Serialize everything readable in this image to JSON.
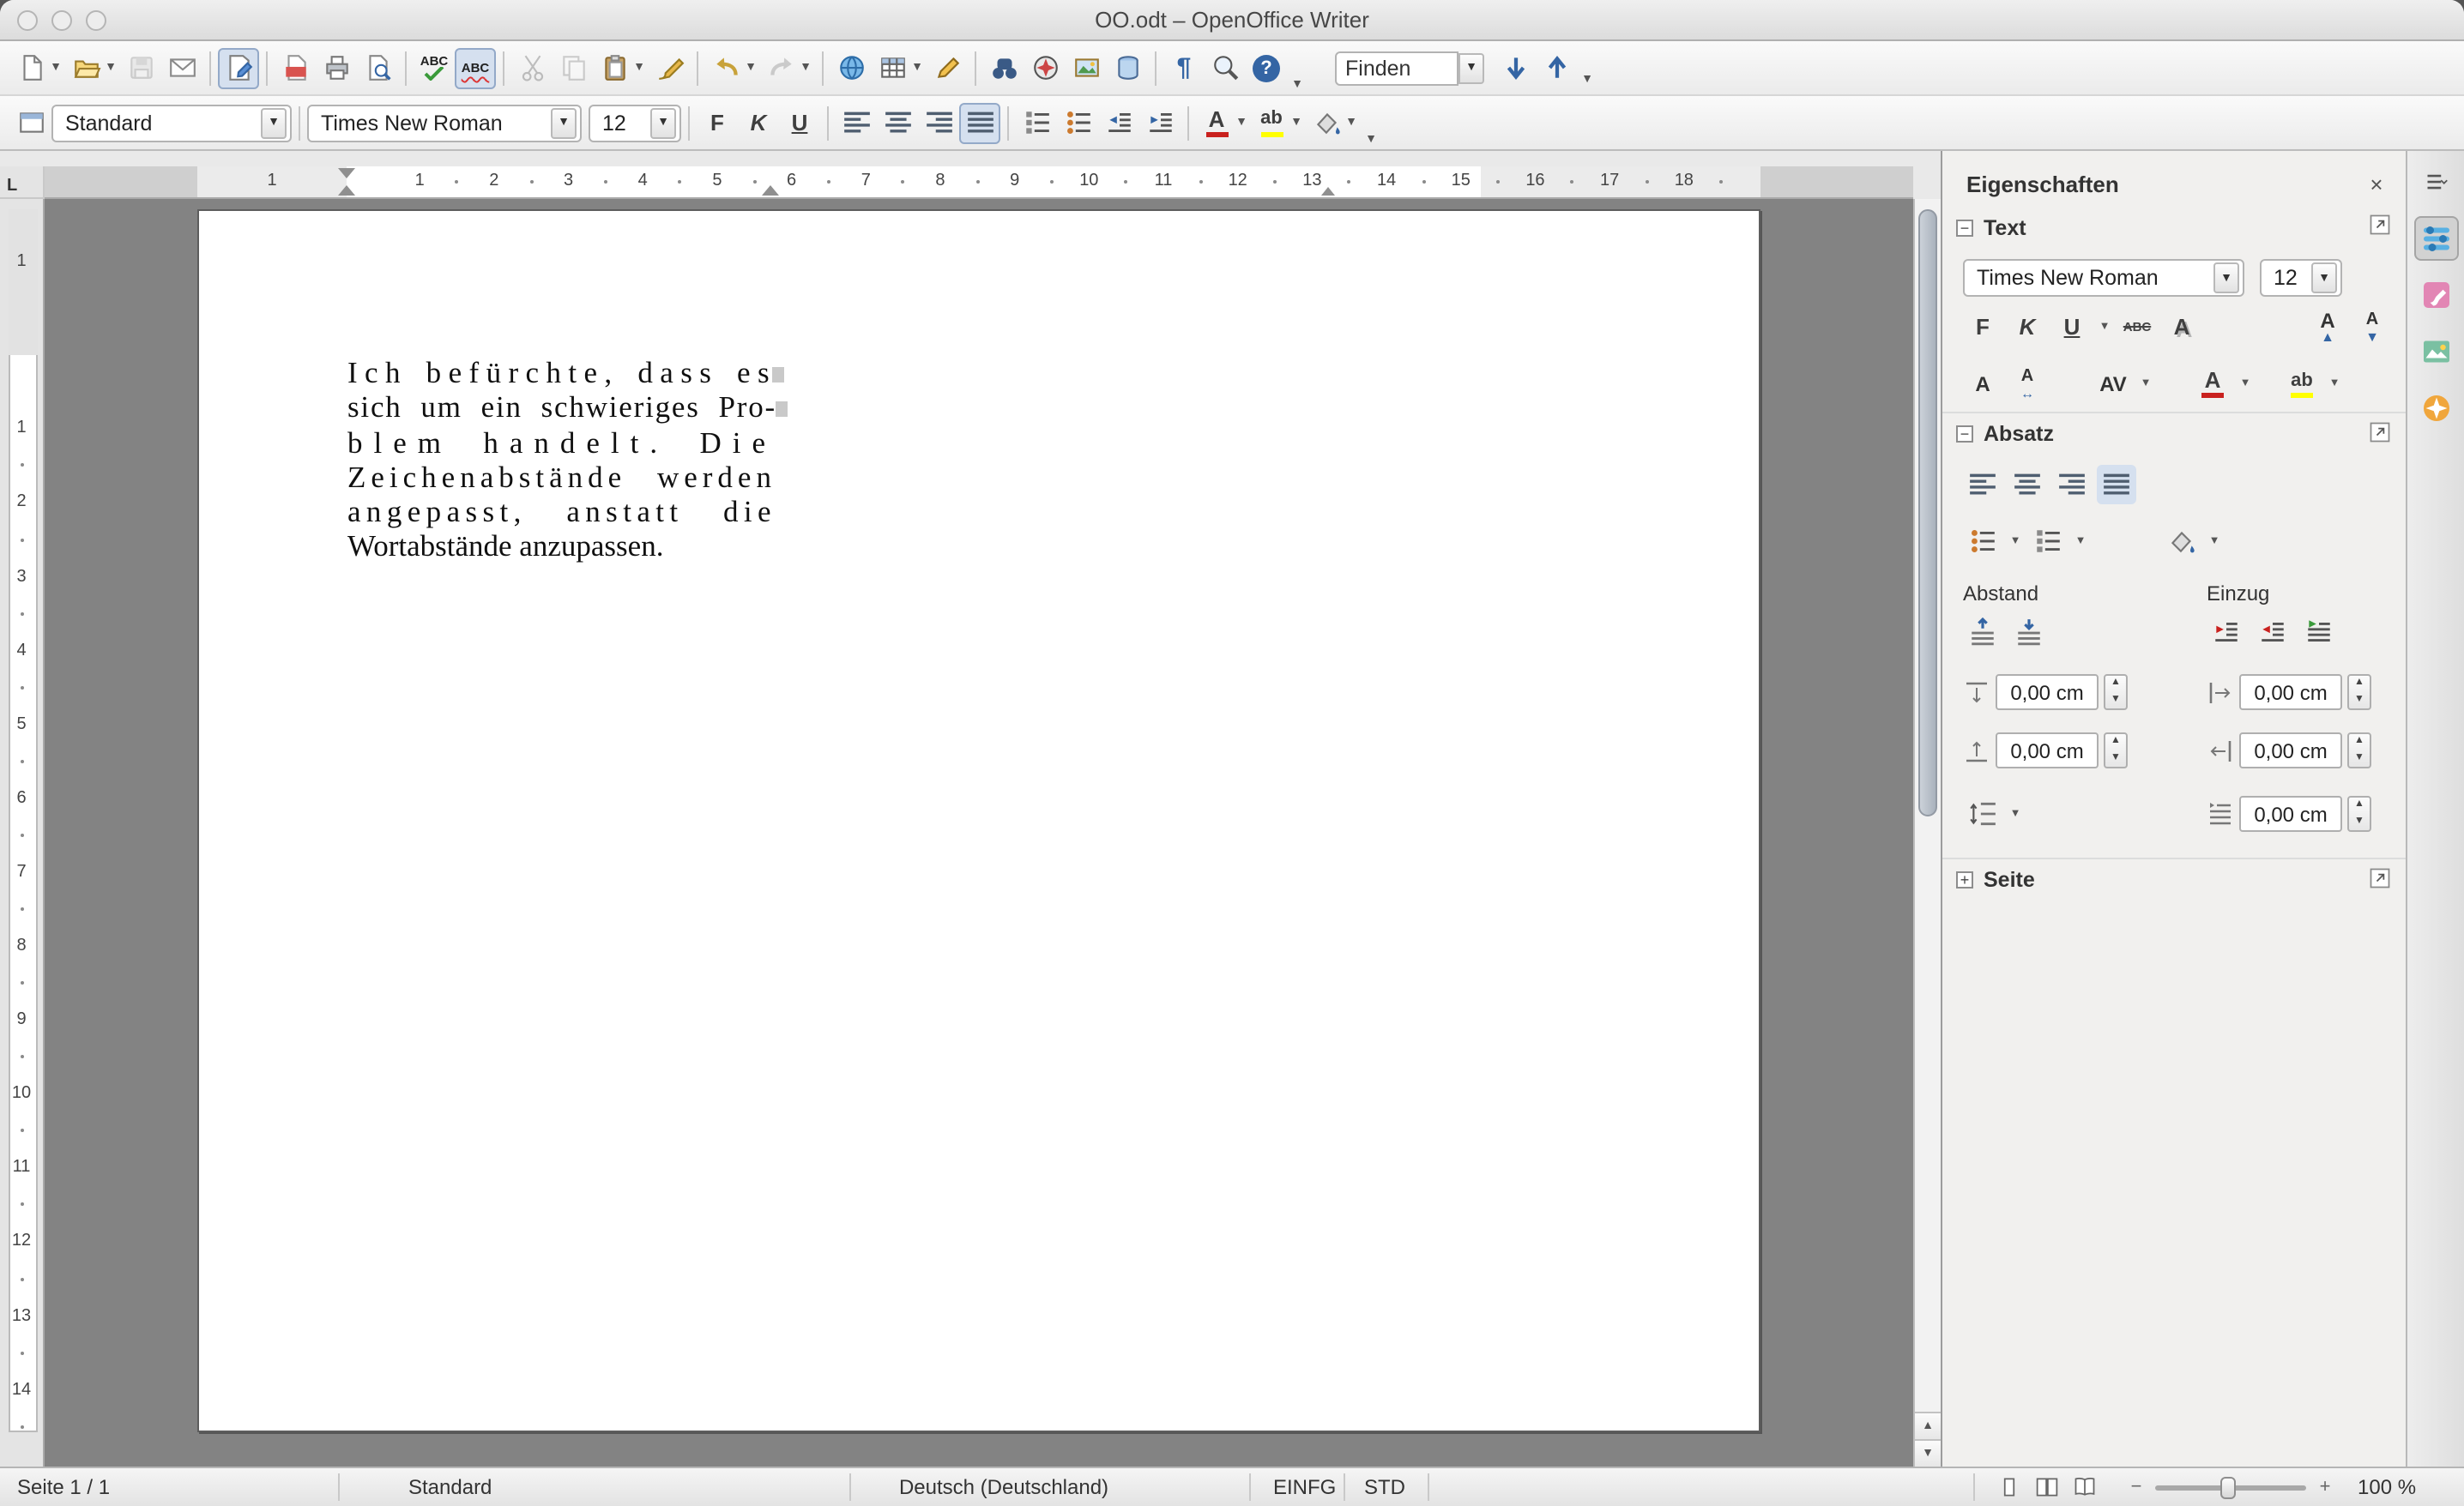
{
  "window": {
    "title": "OO.odt – OpenOffice Writer"
  },
  "toolbar_main": {
    "find_value": "Finden"
  },
  "toolbar_format": {
    "style_value": "Standard",
    "font_value": "Times New Roman",
    "size_value": "12"
  },
  "icons": {
    "close": "×",
    "collapse": "−",
    "expand": "+",
    "bold": "F",
    "italic": "K",
    "underline": "U",
    "strike": "ABC",
    "shadow": "A",
    "spell": "ABC",
    "help": "?",
    "fontcolor_letter": "A",
    "highlight_letters": "ab",
    "kerning": "AV",
    "spacing_letter": "A",
    "arrow_lr": "↔",
    "tab_selector": "L",
    "paragraph_mark": "¶",
    "zoom_out": "−",
    "zoom_in": "+",
    "up_arrow": "▲",
    "down_arrow": "▼",
    "menu_arrow": "▾"
  },
  "ruler": {
    "h_margin": "1",
    "h_numbers": [
      "1",
      "2",
      "3",
      "4",
      "5",
      "6",
      "7",
      "8",
      "9",
      "10",
      "11",
      "12",
      "13",
      "14",
      "15",
      "16",
      "17",
      "18"
    ],
    "v_margin": "1",
    "v_numbers": [
      "1",
      "2",
      "3",
      "4",
      "5",
      "6",
      "7",
      "8",
      "9",
      "10",
      "11",
      "12",
      "13",
      "14"
    ]
  },
  "document": {
    "lines": [
      "Ich befürchte, dass es",
      "sich um ein schwieriges Pro-",
      "blem handelt. Die",
      "Zeichenabstände werden",
      "angepasst, anstatt die",
      "Wortabstände anzupassen."
    ]
  },
  "sidebar": {
    "title": "Eigenschaften",
    "text_section": {
      "label": "Text",
      "font": "Times New Roman",
      "size": "12"
    },
    "paragraph_section": {
      "label": "Absatz",
      "spacing_label": "Abstand",
      "indent_label": "Einzug",
      "above": "0,00 cm",
      "below": "0,00 cm",
      "before": "0,00 cm",
      "after": "0,00 cm",
      "first_line": "0,00 cm"
    },
    "page_section": {
      "label": "Seite"
    }
  },
  "statusbar": {
    "page": "Seite 1 / 1",
    "style": "Standard",
    "language": "Deutsch (Deutschland)",
    "insert_mode": "EINFG",
    "selection_mode": "STD",
    "zoom": "100 %"
  }
}
